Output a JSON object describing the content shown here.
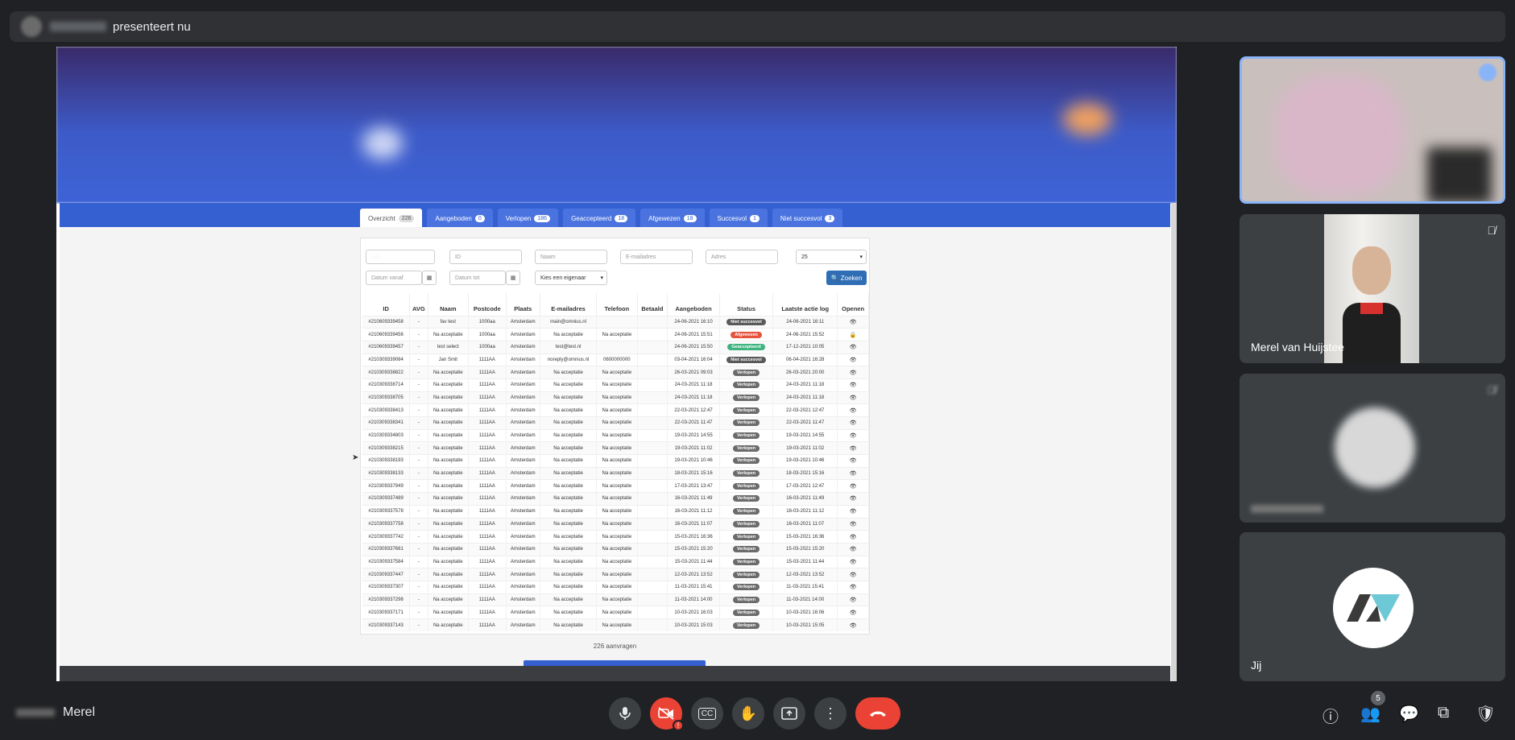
{
  "top_bar": {
    "presenting_label": "presenteert nu"
  },
  "share": {
    "tabs": [
      {
        "label": "Overzicht",
        "count": "226"
      },
      {
        "label": "Aangeboden",
        "count": "0"
      },
      {
        "label": "Verlopen",
        "count": "186"
      },
      {
        "label": "Geaccepteerd",
        "count": "18"
      },
      {
        "label": "Afgewezen",
        "count": "18"
      },
      {
        "label": "Succesvol",
        "count": "1"
      },
      {
        "label": "Niet succesvol",
        "count": "3"
      }
    ],
    "filters": {
      "id_placeholder": "ID",
      "naam_placeholder": "Naam",
      "email_placeholder": "E-mailadres",
      "adres_placeholder": "Adres",
      "page_size": "25",
      "datum_vanaf": "Datum vanaf",
      "datum_tot": "Datum tot",
      "eigenaar": "Kies een eigenaar",
      "search_label": "Zoeken"
    },
    "columns": [
      "ID",
      "AVG",
      "Naam",
      "Postcode",
      "Plaats",
      "E-mailadres",
      "Telefoon",
      "Betaald",
      "Aangeboden",
      "Status",
      "Laatste actie log",
      "Openen"
    ],
    "rows": [
      [
        "#210609339458",
        "-",
        "fav test",
        "1000aa",
        "Amsterdam",
        "main@omnius.nl",
        "",
        "",
        "24-06-2021 16:10",
        "Niet succesvol",
        "24-06-2021 16:11"
      ],
      [
        "#210609339456",
        "-",
        "Na acceptatie",
        "1000aa",
        "Amsterdam",
        "Na acceptatie",
        "Na acceptatie",
        "",
        "24-06-2021 15:51",
        "Afgewezen",
        "24-06-2021 15:52"
      ],
      [
        "#210609339457",
        "-",
        "test select",
        "1000aa",
        "Amsterdam",
        "test@test.nl",
        "",
        "",
        "24-06-2021 15:50",
        "Geaccepteerd",
        "17-12-2021 10:05"
      ],
      [
        "#210309339084",
        "-",
        "Jan Smit",
        "1111AA",
        "Amsterdam",
        "noreply@omnius.nl",
        "0600000000",
        "",
        "03-04-2021 16:04",
        "Niet succesvol",
        "06-04-2021 16:28"
      ],
      [
        "#210309338822",
        "-",
        "Na acceptatie",
        "1111AA",
        "Amsterdam",
        "Na acceptatie",
        "Na acceptatie",
        "",
        "26-03-2021 09:03",
        "Verlopen",
        "26-03-2021 20:00"
      ],
      [
        "#210309338714",
        "-",
        "Na acceptatie",
        "1111AA",
        "Amsterdam",
        "Na acceptatie",
        "Na acceptatie",
        "",
        "24-03-2021 11:18",
        "Verlopen",
        "24-03-2021 11:18"
      ],
      [
        "#210309338705",
        "-",
        "Na acceptatie",
        "1111AA",
        "Amsterdam",
        "Na acceptatie",
        "Na acceptatie",
        "",
        "24-03-2021 11:18",
        "Verlopen",
        "24-03-2021 11:18"
      ],
      [
        "#210309338413",
        "-",
        "Na acceptatie",
        "1111AA",
        "Amsterdam",
        "Na acceptatie",
        "Na acceptatie",
        "",
        "22-03-2021 12:47",
        "Verlopen",
        "22-03-2021 12:47"
      ],
      [
        "#210309338341",
        "-",
        "Na acceptatie",
        "1111AA",
        "Amsterdam",
        "Na acceptatie",
        "Na acceptatie",
        "",
        "22-03-2021 11:47",
        "Verlopen",
        "22-03-2021 11:47"
      ],
      [
        "#210309334803",
        "-",
        "Na acceptatie",
        "1111AA",
        "Amsterdam",
        "Na acceptatie",
        "Na acceptatie",
        "",
        "19-03-2021 14:55",
        "Verlopen",
        "19-03-2021 14:55"
      ],
      [
        "#210309338215",
        "-",
        "Na acceptatie",
        "1111AA",
        "Amsterdam",
        "Na acceptatie",
        "Na acceptatie",
        "",
        "19-03-2021 11:02",
        "Verlopen",
        "19-03-2021 11:02"
      ],
      [
        "#210309338193",
        "-",
        "Na acceptatie",
        "1111AA",
        "Amsterdam",
        "Na acceptatie",
        "Na acceptatie",
        "",
        "19-03-2021 10:46",
        "Verlopen",
        "19-03-2021 10:46"
      ],
      [
        "#210309338133",
        "-",
        "Na acceptatie",
        "1111AA",
        "Amsterdam",
        "Na acceptatie",
        "Na acceptatie",
        "",
        "18-03-2021 15:16",
        "Verlopen",
        "18-03-2021 15:16"
      ],
      [
        "#210309337949",
        "-",
        "Na acceptatie",
        "1111AA",
        "Amsterdam",
        "Na acceptatie",
        "Na acceptatie",
        "",
        "17-03-2021 13:47",
        "Verlopen",
        "17-03-2021 12:47"
      ],
      [
        "#210309337489",
        "-",
        "Na acceptatie",
        "1111AA",
        "Amsterdam",
        "Na acceptatie",
        "Na acceptatie",
        "",
        "16-03-2021 11:49",
        "Verlopen",
        "16-03-2021 11:49"
      ],
      [
        "#210309337578",
        "-",
        "Na acceptatie",
        "1111AA",
        "Amsterdam",
        "Na acceptatie",
        "Na acceptatie",
        "",
        "16-03-2021 11:12",
        "Verlopen",
        "16-03-2021 11:12"
      ],
      [
        "#210309337758",
        "-",
        "Na acceptatie",
        "1111AA",
        "Amsterdam",
        "Na acceptatie",
        "Na acceptatie",
        "",
        "16-03-2021 11:07",
        "Verlopen",
        "16-03-2021 11:07"
      ],
      [
        "#210309337742",
        "-",
        "Na acceptatie",
        "1111AA",
        "Amsterdam",
        "Na acceptatie",
        "Na acceptatie",
        "",
        "15-03-2021 16:36",
        "Verlopen",
        "15-03-2021 16:36"
      ],
      [
        "#210309337681",
        "-",
        "Na acceptatie",
        "1111AA",
        "Amsterdam",
        "Na acceptatie",
        "Na acceptatie",
        "",
        "15-03-2021 15:20",
        "Verlopen",
        "15-03-2021 15:20"
      ],
      [
        "#210309337584",
        "-",
        "Na acceptatie",
        "1111AA",
        "Amsterdam",
        "Na acceptatie",
        "Na acceptatie",
        "",
        "15-03-2021 11:44",
        "Verlopen",
        "15-03-2021 11:44"
      ],
      [
        "#210309337447",
        "-",
        "Na acceptatie",
        "1111AA",
        "Amsterdam",
        "Na acceptatie",
        "Na acceptatie",
        "",
        "12-03-2021 13:52",
        "Verlopen",
        "12-03-2021 13:52"
      ],
      [
        "#210309337307",
        "-",
        "Na acceptatie",
        "1111AA",
        "Amsterdam",
        "Na acceptatie",
        "Na acceptatie",
        "",
        "11-03-2021 15:41",
        "Verlopen",
        "11-03-2021 15:41"
      ],
      [
        "#210309337298",
        "-",
        "Na acceptatie",
        "1111AA",
        "Amsterdam",
        "Na acceptatie",
        "Na acceptatie",
        "",
        "11-03-2021 14:00",
        "Verlopen",
        "11-03-2021 14:00"
      ],
      [
        "#210309337171",
        "-",
        "Na acceptatie",
        "1111AA",
        "Amsterdam",
        "Na acceptatie",
        "Na acceptatie",
        "",
        "10-03-2021 16:03",
        "Verlopen",
        "10-03-2021 16:06"
      ],
      [
        "#210309337143",
        "-",
        "Na acceptatie",
        "1111AA",
        "Amsterdam",
        "Na acceptatie",
        "Na acceptatie",
        "",
        "10-03-2021 15:03",
        "Verlopen",
        "10-03-2021 15:05"
      ]
    ],
    "status_colors": {
      "Niet succesvol": "#5a5a5a",
      "Afgewezen": "#e5533d",
      "Geaccepteerd": "#3fb37f",
      "Verlopen": "#6b6b6b"
    },
    "total_label": "226 aanvragen"
  },
  "participants": [
    {
      "name": ""
    },
    {
      "name": "Merel van Huijstee"
    },
    {
      "name": ""
    },
    {
      "name": "Jij"
    }
  ],
  "bottom": {
    "my_name": "Merel",
    "people_count": "5"
  }
}
